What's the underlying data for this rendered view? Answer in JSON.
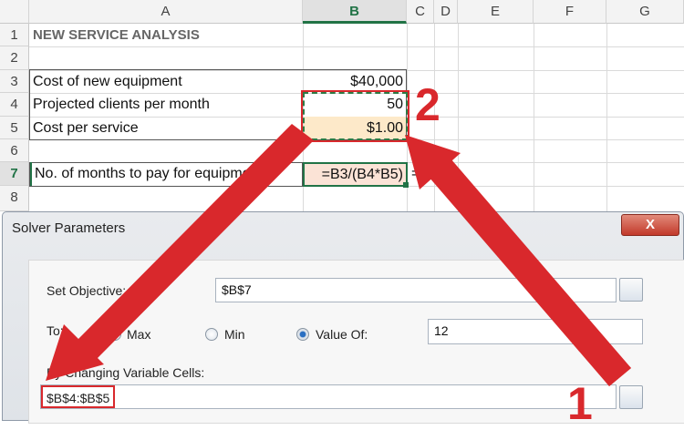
{
  "columns": [
    "A",
    "B",
    "C",
    "D",
    "E",
    "F",
    "G"
  ],
  "rows": [
    "1",
    "2",
    "3",
    "4",
    "5",
    "6",
    "7",
    "8"
  ],
  "cells": {
    "a1": "NEW SERVICE ANALYSIS",
    "a3": "Cost of new equipment",
    "b3": "$40,000",
    "a4": "Projected clients per month",
    "b4": "50",
    "a5": "Cost per service",
    "b5": "$1.00",
    "a7": "No. of months to pay for equipment",
    "b7": "=B3/(B4*B5)",
    "c7": "="
  },
  "annotations": {
    "step1": "1",
    "step2": "2",
    "arrow_color": "#d9282c"
  },
  "dialog": {
    "title": "Solver Parameters",
    "close": "X",
    "set_objective_label": "Set Objective:",
    "set_objective_value": "$B$7",
    "to_label": "To:",
    "max_label": "Max",
    "min_label": "Min",
    "value_of_label": "Value Of:",
    "selected": "Value Of",
    "value_of_value": "12",
    "changing_label": "By Changing Variable Cells:",
    "changing_value": "$B$4:$B$5"
  }
}
